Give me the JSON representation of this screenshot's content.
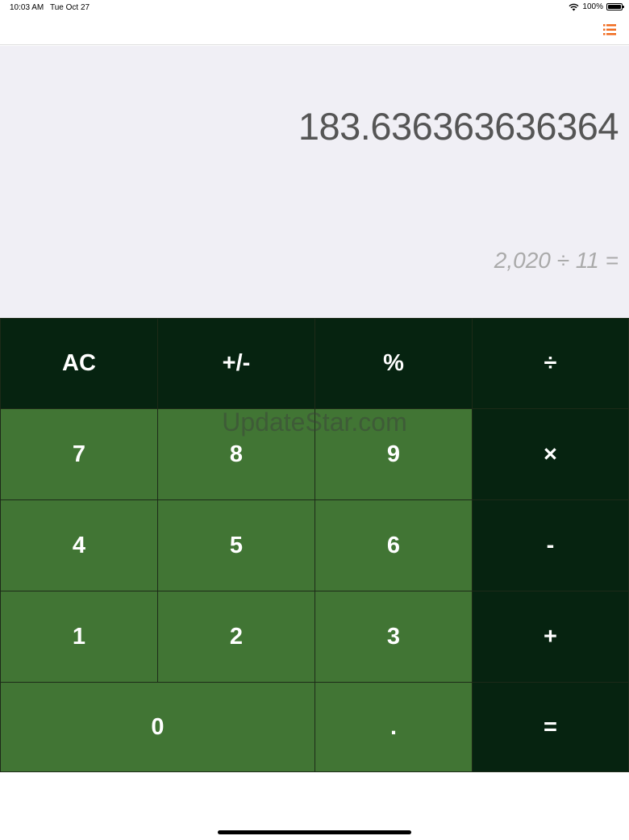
{
  "status_bar": {
    "time": "10:03 AM",
    "date": "Tue Oct 27",
    "battery": "100%"
  },
  "nav": {
    "history_icon": "list-icon",
    "accent_color": "#f06a1d"
  },
  "display": {
    "result": "183.636363636364",
    "expression": "2,020 ÷ 11  ="
  },
  "keypad": {
    "colors": {
      "operator": "#062310",
      "digit": "#417534"
    },
    "keys": {
      "clear": "AC",
      "negate": "+/-",
      "percent": "%",
      "divide": "÷",
      "seven": "7",
      "eight": "8",
      "nine": "9",
      "multiply": "×",
      "four": "4",
      "five": "5",
      "six": "6",
      "subtract": "-",
      "one": "1",
      "two": "2",
      "three": "3",
      "add": "+",
      "zero": "0",
      "decimal": ".",
      "equals": "="
    }
  },
  "watermark": "UpdateStar.com"
}
